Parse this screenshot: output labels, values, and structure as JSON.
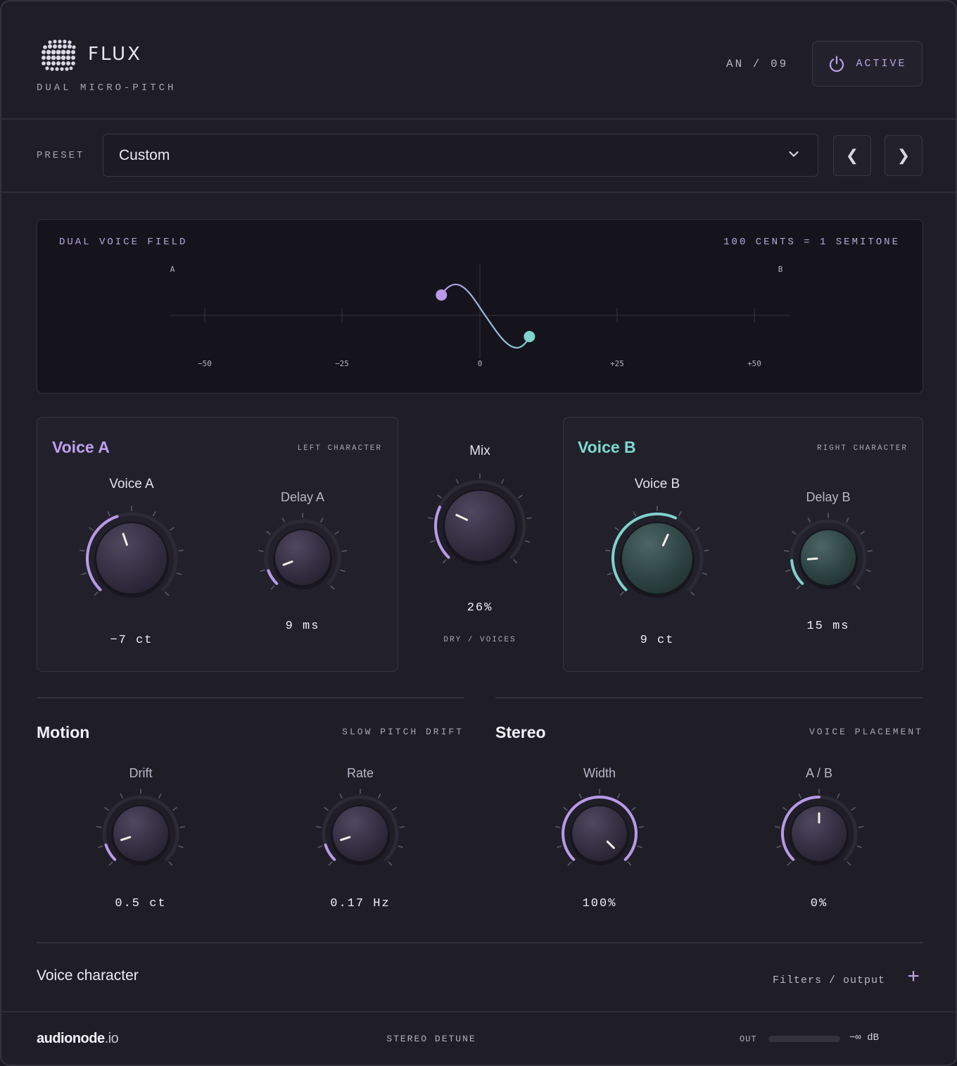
{
  "header": {
    "title": "FLUX",
    "subtitle": "DUAL MICRO-PITCH",
    "version": "AN / 09",
    "active_label": "ACTIVE"
  },
  "preset": {
    "label": "PRESET",
    "value": "Custom",
    "prev": "❮",
    "next": "❯"
  },
  "field": {
    "title": "DUAL VOICE FIELD",
    "note": "100 CENTS = 1 SEMITONE",
    "label_a": "A",
    "label_b": "B",
    "ticks": [
      "−50",
      "−25",
      "0",
      "+25",
      "+50"
    ],
    "voice_a_cents": -7,
    "voice_b_cents": 9
  },
  "voice_a": {
    "title": "Voice A",
    "tag": "LEFT CHARACTER",
    "pitch_label": "Voice A",
    "pitch_value": "−7 ct",
    "delay_label": "Delay A",
    "delay_value": "9 ms"
  },
  "mix": {
    "label": "Mix",
    "value": "26%",
    "tag": "DRY / VOICES"
  },
  "voice_b": {
    "title": "Voice B",
    "tag": "RIGHT CHARACTER",
    "pitch_label": "Voice B",
    "pitch_value": "9 ct",
    "delay_label": "Delay B",
    "delay_value": "15 ms"
  },
  "motion": {
    "title": "Motion",
    "tag": "SLOW PITCH DRIFT",
    "drift_label": "Drift",
    "drift_value": "0.5 ct",
    "rate_label": "Rate",
    "rate_value": "0.17 Hz"
  },
  "stereo": {
    "title": "Stereo",
    "tag": "VOICE PLACEMENT",
    "width_label": "Width",
    "width_value": "100%",
    "ab_label": "A / B",
    "ab_value": "0%"
  },
  "character": {
    "title": "Voice character",
    "hint": "Filters / output",
    "expand": "+"
  },
  "footer": {
    "brand": "audionode",
    "brand_suffix": ".io",
    "center": "STEREO DETUNE",
    "out_label": "OUT",
    "out_value": "−∞ dB",
    "out_level": 0
  },
  "colors": {
    "voice_a": "#b89ae8",
    "voice_b": "#7fd3cc",
    "accent": "#b9a2e6"
  },
  "knob_levels": {
    "voice_a": 0.43,
    "delay_a": 0.09,
    "mix": 0.26,
    "voice_b": 0.59,
    "delay_b": 0.15,
    "drift": 0.1,
    "rate": 0.1,
    "width": 1.0,
    "ab": 0.5
  }
}
